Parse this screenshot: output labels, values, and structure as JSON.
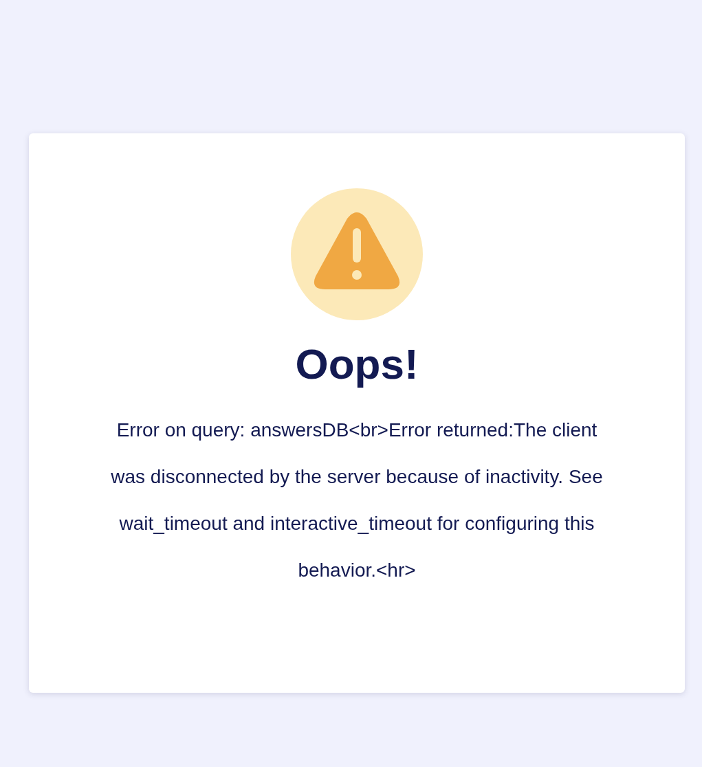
{
  "card": {
    "title": "Oops!",
    "message": "Error on query: answersDB<br>Error returned:The client was disconnected by the server because of inactivity. See wait_timeout and interactive_timeout for configuring this behavior.<hr>"
  }
}
